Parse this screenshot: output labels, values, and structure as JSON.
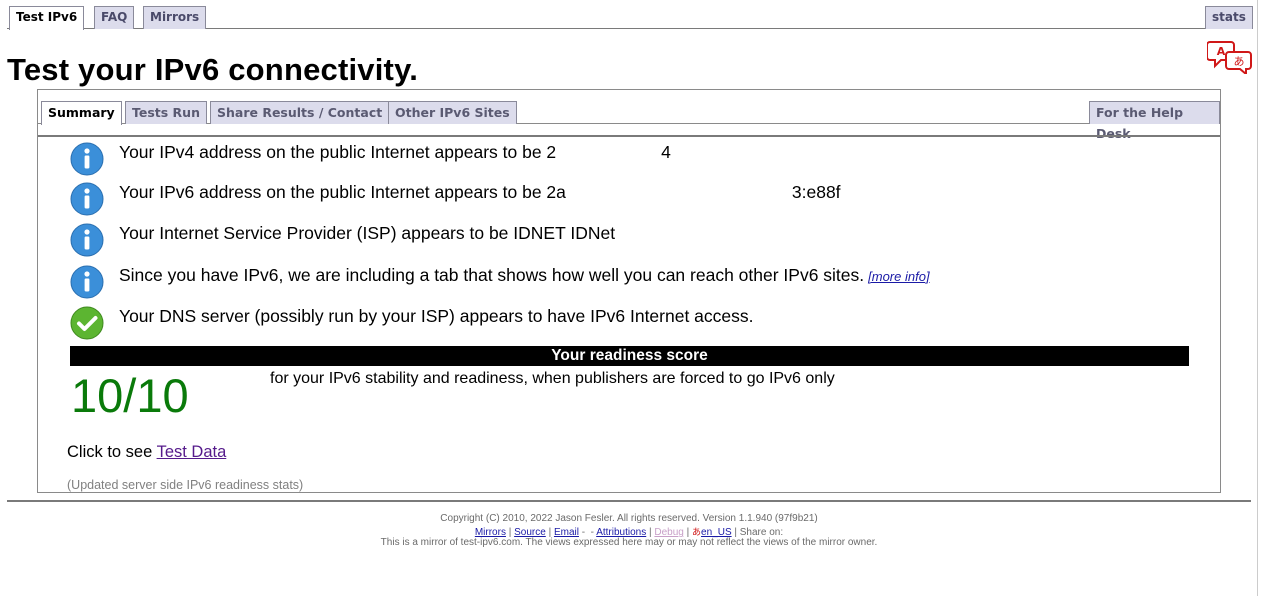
{
  "top_tabs": [
    {
      "label": "Test IPv6",
      "active": true
    },
    {
      "label": "FAQ",
      "active": false
    },
    {
      "label": "Mirrors",
      "active": false
    }
  ],
  "stats_label": "stats",
  "page_title": "Test your IPv6 connectivity.",
  "sub_tabs": [
    {
      "label": "Summary",
      "active": true
    },
    {
      "label": "Tests Run",
      "active": false
    },
    {
      "label": "Share Results / Contact",
      "active": false
    },
    {
      "label": "Other IPv6 Sites",
      "active": false
    }
  ],
  "help_desk_label": "For the Help Desk",
  "results": [
    {
      "icon": "info-icon",
      "text_prefix": "Your IPv4 address on the public Internet appears to be 2",
      "text_suffix": "4"
    },
    {
      "icon": "info-icon",
      "text_prefix": "Your IPv6 address on the public Internet appears to be 2a",
      "text_suffix": "3:e88f"
    },
    {
      "icon": "info-icon",
      "text": "Your Internet Service Provider (ISP) appears to be IDNET IDNet"
    },
    {
      "icon": "info-icon",
      "text": "Since you have IPv6, we are including a tab that shows how well you can reach other IPv6 sites.",
      "link": "[more info]"
    },
    {
      "icon": "check-icon",
      "text": "Your DNS server (possibly run by your ISP) appears to have IPv6 Internet access."
    }
  ],
  "score": {
    "heading": "Your readiness score",
    "value": "10/10",
    "description": "for your IPv6 stability and readiness, when publishers are forced to go IPv6 only"
  },
  "test_data": {
    "prefix": "Click to see ",
    "link": "Test Data"
  },
  "updated_stats": "(Updated server side IPv6 readiness stats)",
  "footer": {
    "copyright": "Copyright (C) 2010, 2022 Jason Fesler. All rights reserved. Version 1.1.940 (97f9b21)",
    "links": {
      "mirrors": "Mirrors",
      "source": "Source",
      "email": "Email",
      "attributions": "Attributions",
      "debug": "Debug",
      "locale": "en_US",
      "share": "Share on:"
    },
    "mirror_note": "This is a mirror of test-ipv6.com. The views expressed here may or may not reflect the views of the mirror owner."
  },
  "colors": {
    "score_green": "#0a7a0a",
    "info_blue": "#3b8fd9",
    "check_green": "#5cb531",
    "translate_red": "#d01818"
  }
}
